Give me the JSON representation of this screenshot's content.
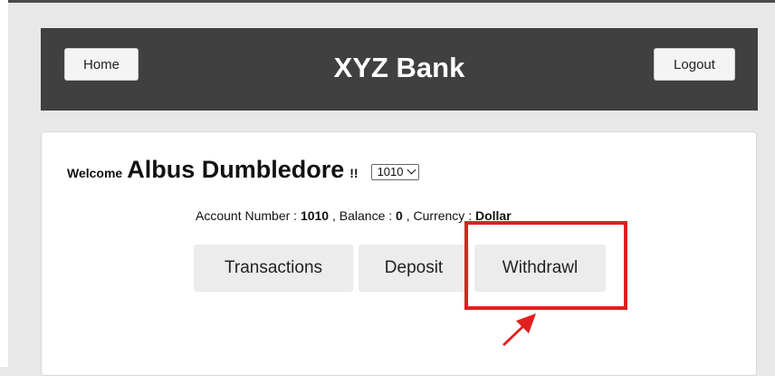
{
  "header": {
    "home_label": "Home",
    "title": "XYZ Bank",
    "logout_label": "Logout"
  },
  "welcome": {
    "label": "Welcome",
    "name": "Albus Dumbledore",
    "suffix": "!!",
    "selected_account": "1010"
  },
  "account": {
    "number_label": "Account Number :",
    "number": "1010",
    "balance_label": ", Balance :",
    "balance": "0",
    "currency_label": ", Currency :",
    "currency": "Dollar"
  },
  "tabs": [
    {
      "label": "Transactions"
    },
    {
      "label": "Deposit"
    },
    {
      "label": "Withdrawl"
    }
  ],
  "colors": {
    "header_bg": "#404040",
    "annotation": "#e21f1f",
    "page_bg": "#e8e8e8"
  },
  "icons": {
    "select": "chevron-down-icon",
    "annotation": "red-arrow-icon"
  }
}
